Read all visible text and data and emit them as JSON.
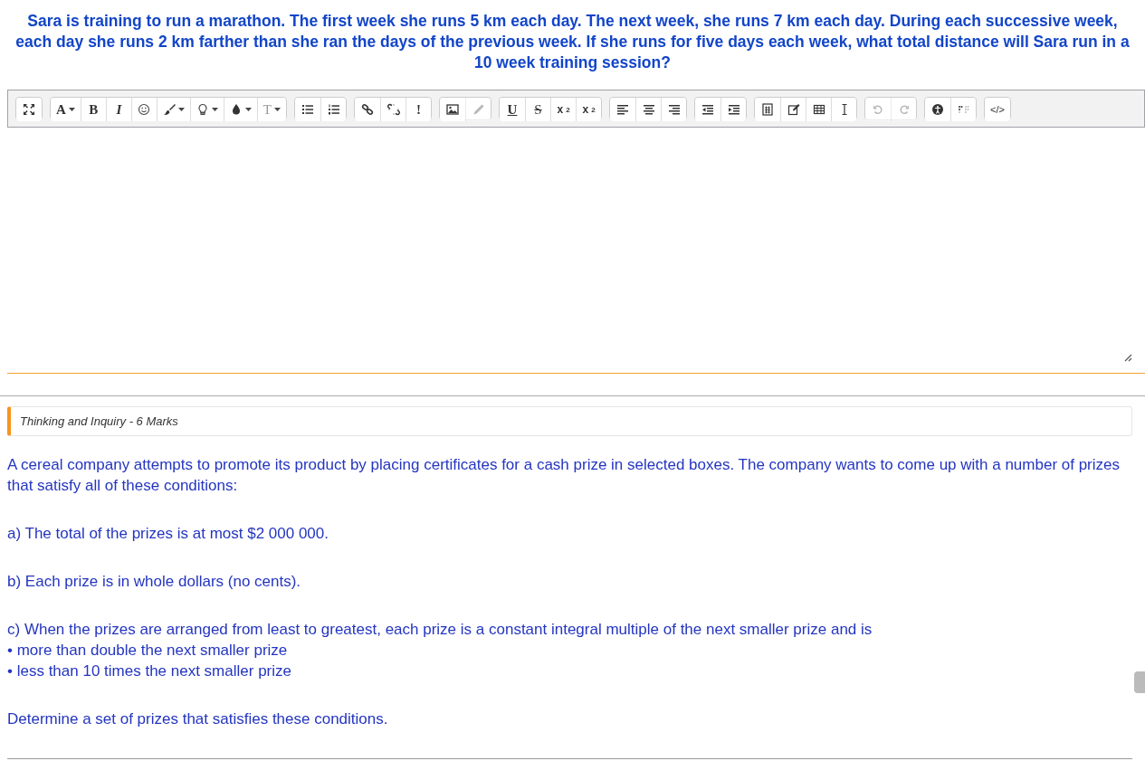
{
  "question": "Sara is training to run a marathon. The first week she runs 5 km each day. The next week, she runs 7 km each day. During each successive week, each day she runs 2 km farther than she ran the days of the previous week. If she runs for five days each week, what total distance will Sara run in a 10 week training session?",
  "toolbar": [
    [
      {
        "kind": "expand",
        "disabled": false
      }
    ],
    [
      {
        "kind": "font-color",
        "label": "A",
        "disabled": false
      },
      {
        "kind": "bold",
        "label": "B",
        "disabled": false
      },
      {
        "kind": "italic",
        "label": "I",
        "disabled": false
      },
      {
        "kind": "smiley",
        "disabled": false
      },
      {
        "kind": "brush",
        "disabled": false
      },
      {
        "kind": "bulb",
        "disabled": false
      },
      {
        "kind": "drop",
        "disabled": false
      },
      {
        "kind": "font-size",
        "label": "T",
        "disabled": true
      }
    ],
    [
      {
        "kind": "bullets",
        "disabled": false
      },
      {
        "kind": "numbers",
        "disabled": false
      }
    ],
    [
      {
        "kind": "link",
        "disabled": false
      },
      {
        "kind": "unlink",
        "disabled": false
      },
      {
        "kind": "bold",
        "label": "!",
        "disabled": false
      }
    ],
    [
      {
        "kind": "image",
        "disabled": false
      },
      {
        "kind": "pencil",
        "disabled": true
      }
    ],
    [
      {
        "kind": "underline",
        "label": "U",
        "disabled": false
      },
      {
        "kind": "strike",
        "label": "S",
        "disabled": false
      },
      {
        "kind": "sub",
        "label": "x",
        "index": "2",
        "disabled": false
      },
      {
        "kind": "sup",
        "label": "x",
        "index": "2",
        "disabled": false
      }
    ],
    [
      {
        "kind": "align-left",
        "disabled": false
      },
      {
        "kind": "align-center",
        "disabled": false
      },
      {
        "kind": "align-right",
        "disabled": false
      }
    ],
    [
      {
        "kind": "outdent",
        "disabled": false
      },
      {
        "kind": "indent",
        "disabled": false
      }
    ],
    [
      {
        "kind": "calculator",
        "disabled": false
      },
      {
        "kind": "edit",
        "disabled": false
      },
      {
        "kind": "table",
        "disabled": false
      },
      {
        "kind": "cursor",
        "disabled": false
      }
    ],
    [
      {
        "kind": "undo",
        "disabled": true
      },
      {
        "kind": "redo",
        "disabled": true
      }
    ],
    [
      {
        "kind": "accessibility",
        "disabled": false
      },
      {
        "kind": "braille",
        "disabled": false
      }
    ],
    [
      {
        "kind": "code",
        "label": "</>",
        "disabled": false
      }
    ]
  ],
  "section_label": "Thinking and Inquiry - 6 Marks",
  "paragraphs": [
    {
      "text": "A cereal company attempts to promote its product by placing certificates for a cash prize in selected boxes. The company wants to come up with a number of prizes that satisfy all of these conditions:"
    },
    {
      "text": "a) The total of the prizes is at most $2 000 000."
    },
    {
      "text": "b) Each prize is in whole dollars (no cents)."
    },
    {
      "text": "c) When the prizes are arranged from least to greatest, each prize is a constant integral multiple of the next smaller prize and is",
      "bullets": [
        "• more than double the next smaller prize",
        "• less than 10 times the next smaller prize"
      ]
    },
    {
      "text": "Determine a set of prizes that satisfies these conditions."
    }
  ]
}
